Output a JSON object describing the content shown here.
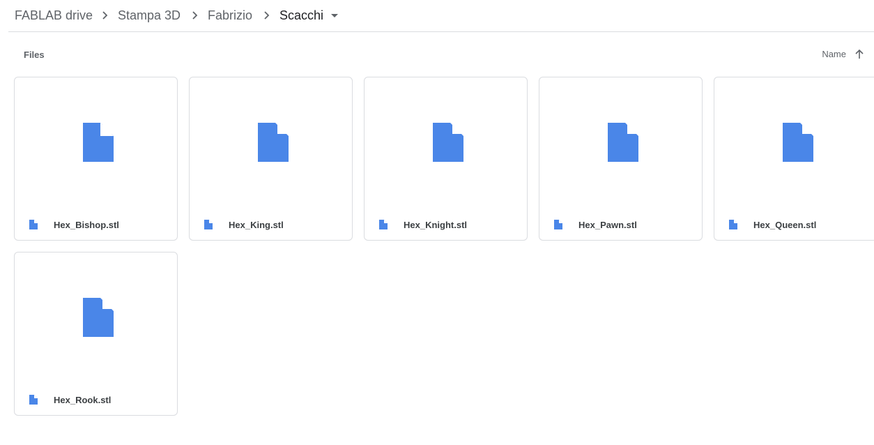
{
  "breadcrumb": [
    {
      "label": "FABLAB drive"
    },
    {
      "label": "Stampa 3D"
    },
    {
      "label": "Fabrizio"
    },
    {
      "label": "Scacchi"
    }
  ],
  "section_label": "Files",
  "sort": {
    "label": "Name",
    "direction": "ascending",
    "icon": "arrow-up-icon"
  },
  "files": [
    {
      "name": "Hex_Bishop.stl",
      "icon": "file-icon"
    },
    {
      "name": "Hex_King.stl",
      "icon": "file-icon"
    },
    {
      "name": "Hex_Knight.stl",
      "icon": "file-icon"
    },
    {
      "name": "Hex_Pawn.stl",
      "icon": "file-icon"
    },
    {
      "name": "Hex_Queen.stl",
      "icon": "file-icon"
    },
    {
      "name": "Hex_Rook.stl",
      "icon": "file-icon"
    }
  ],
  "colors": {
    "file_icon": "#4a86e8",
    "border": "#dadce0",
    "text": "#3c4043"
  }
}
